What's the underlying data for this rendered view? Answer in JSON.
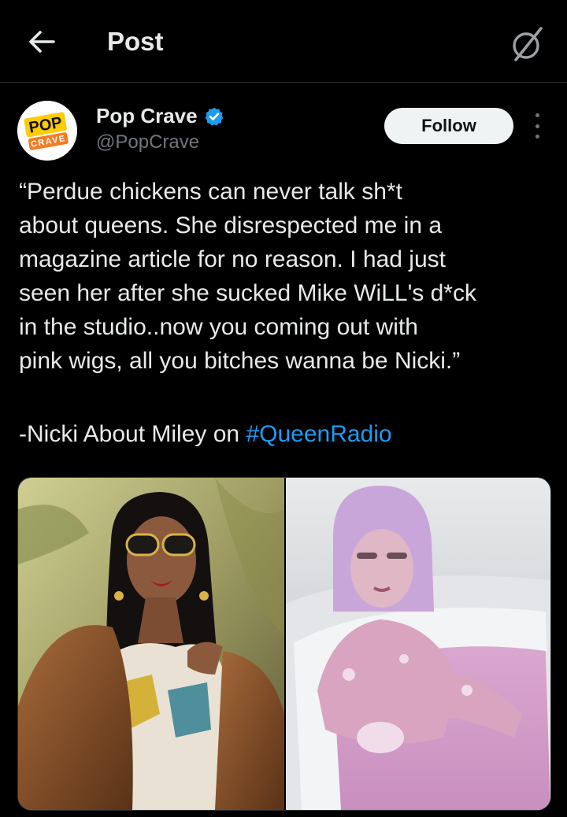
{
  "header": {
    "title": "Post",
    "back_icon": "arrow-left-icon",
    "grok_icon": "grok-icon"
  },
  "author": {
    "name": "Pop Crave",
    "handle": "@PopCrave",
    "verified": true,
    "verified_color": "#1d9bf0",
    "avatar_text_top": "POP",
    "avatar_text_bottom": "CRAVE"
  },
  "follow_label": "Follow",
  "post": {
    "text": "“Perdue chickens can never talk sh*t\nabout queens. She disrespected me in a\nmagazine article for no reason. I had just\nseen her after she sucked Mike WiLL's d*ck\nin the studio..now you coming out with\npink wigs, all you bitches wanna be Nicki.”",
    "attribution_prefix": "-Nicki About Miley on ",
    "hashtag": "#QueenRadio",
    "hashtag_color": "#1d9bf0"
  },
  "media": {
    "count": 2
  }
}
